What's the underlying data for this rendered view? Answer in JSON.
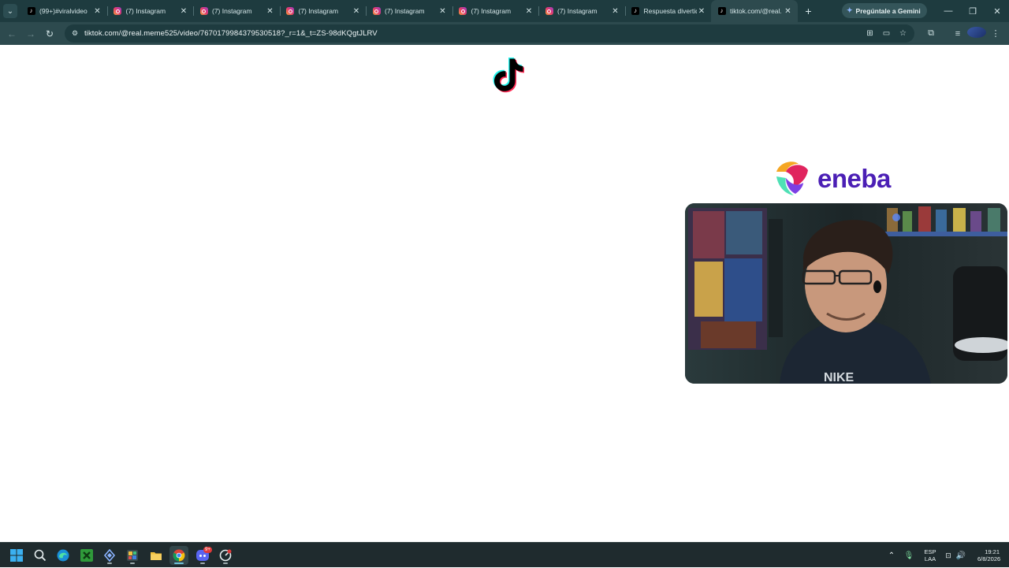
{
  "browser": {
    "tabs": [
      {
        "title": "(99+)#viralvideo",
        "favicon": "tiktok-favicon",
        "active": false
      },
      {
        "title": "(7) Instagram",
        "favicon": "instagram-favicon",
        "active": false
      },
      {
        "title": "(7) Instagram",
        "favicon": "instagram-favicon",
        "active": false
      },
      {
        "title": "(7) Instagram",
        "favicon": "instagram-favicon",
        "active": false
      },
      {
        "title": "(7) Instagram",
        "favicon": "instagram-favicon",
        "active": false
      },
      {
        "title": "(7) Instagram",
        "favicon": "instagram-favicon",
        "active": false
      },
      {
        "title": "(7) Instagram",
        "favicon": "instagram-favicon",
        "active": false
      },
      {
        "title": "Respuesta divertid",
        "favicon": "tiktok-favicon",
        "active": false
      },
      {
        "title": "tiktok.com/@real.",
        "favicon": "tiktok-favicon",
        "active": true
      }
    ],
    "gemini_label": "Pregúntale a Gemini",
    "url": "tiktok.com/@real.meme525/video/7670179984379530518?_r=1&_t=ZS-98dKQgtJLRV"
  },
  "page": {
    "logo": "tiktok-logo",
    "sponsor_wordmark": "eneba",
    "webcam_overlay": "webcam-feed"
  },
  "taskbar": {
    "apps": [
      "windows-start-icon",
      "search-icon",
      "edge-icon",
      "xbox-icon",
      "app-icon",
      "app-icon",
      "file-explorer-icon",
      "chrome-icon",
      "discord-icon",
      "app-icon"
    ],
    "discord_badge": "9+",
    "language_top": "ESP",
    "language_bottom": "LAA",
    "time": "19:21",
    "date": "6/8/2026"
  },
  "colors": {
    "tab_strip": "#1e3b3f",
    "toolbar": "#2d4a4e",
    "eneba_purple": "#4b1fb5",
    "tiktok_cyan": "#25f4ee",
    "tiktok_red": "#fe2c55"
  }
}
